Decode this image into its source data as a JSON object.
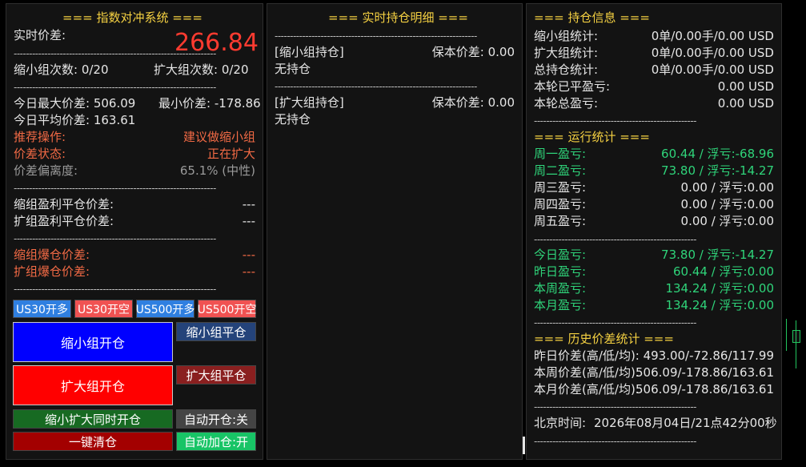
{
  "left": {
    "title": "=== 指数对冲系统 ===",
    "realtime_label": "实时价差:",
    "realtime_value": "266.84",
    "shrink_count": "缩小组次数: 0/20",
    "expand_count": "扩大组次数: 0/20",
    "today_max": "今日最大价差: 506.09",
    "today_min": "最小价差: -178.86",
    "today_avg": "今日平均价差: 163.61",
    "recommend_label": "推荐操作:",
    "recommend_value": "建议做缩小组",
    "spread_state_label": "价差状态:",
    "spread_state_value": "正在扩大",
    "deviation_label": "价差偏离度:",
    "deviation_value": "65.1% (中性)",
    "shrink_tp_label": "缩组盈利平仓价差:",
    "shrink_tp_value": "---",
    "expand_tp_label": "扩组盈利平仓价差:",
    "expand_tp_value": "---",
    "shrink_liq_label": "缩组爆仓价差:",
    "shrink_liq_value": "---",
    "expand_liq_label": "扩组爆仓价差:",
    "expand_liq_value": "---",
    "buttons": {
      "us30_long": "US30开多",
      "us30_short": "US30开空",
      "us500_long": "US500开多",
      "us500_short": "US500开空",
      "shrink_open": "缩小组开仓",
      "shrink_close": "缩小组平仓",
      "expand_open": "扩大组开仓",
      "expand_close": "扩大组平仓",
      "both_open": "缩小扩大同时开仓",
      "auto_open": "自动开仓:关",
      "close_all": "一键清仓",
      "auto_add": "自动加仓:开"
    }
  },
  "middle": {
    "title": "=== 实时持仓明细 ===",
    "shrink_header": "[缩小组持仓]",
    "shrink_breakeven": "保本价差: 0.00",
    "shrink_none": "无持仓",
    "expand_header": "[扩大组持仓]",
    "expand_breakeven": "保本价差: 0.00",
    "expand_none": "无持仓"
  },
  "right": {
    "pos_title": "=== 持仓信息 ===",
    "pos_rows": [
      {
        "label": "缩小组统计:",
        "value": "0单/0.00手/0.00 USD"
      },
      {
        "label": "扩大组统计:",
        "value": "0单/0.00手/0.00 USD"
      },
      {
        "label": "总持仓统计:",
        "value": "0单/0.00手/0.00 USD"
      },
      {
        "label": "本轮已平盈亏:",
        "value": "0.00 USD"
      },
      {
        "label": "本轮总盈亏:",
        "value": "0.00 USD"
      }
    ],
    "run_title": "=== 运行统计 ===",
    "week_rows": [
      {
        "label": "周一盈亏:",
        "value": "60.44 / 浮亏:-68.96"
      },
      {
        "label": "周二盈亏:",
        "value": "73.80 / 浮亏:-14.27"
      },
      {
        "label": "周三盈亏:",
        "value": "0.00 / 浮亏:0.00"
      },
      {
        "label": "周四盈亏:",
        "value": "0.00 / 浮亏:0.00"
      },
      {
        "label": "周五盈亏:",
        "value": "0.00 / 浮亏:0.00"
      }
    ],
    "period_rows": [
      {
        "label": "今日盈亏:",
        "value": "73.80 / 浮亏:-14.27"
      },
      {
        "label": "昨日盈亏:",
        "value": "60.44 / 浮亏:0.00"
      },
      {
        "label": "本周盈亏:",
        "value": "134.24 / 浮亏:0.00"
      },
      {
        "label": "本月盈亏:",
        "value": "134.24 / 浮亏:0.00"
      }
    ],
    "hist_title": "=== 历史价差统计 ===",
    "hist_rows": [
      {
        "label": "昨日价差(高/低/均):",
        "value": "493.00/-72.86/117.99"
      },
      {
        "label": "本周价差(高/低/均):",
        "value": "506.09/-178.86/163.61"
      },
      {
        "label": "本月价差(高/低/均):",
        "value": "506.09/-178.86/163.61"
      }
    ],
    "time_label": "北京时间:",
    "time_value": "2026年08月04日/21点42分00秒"
  },
  "colors": {
    "accent_title": "#f5d142",
    "red": "#ff3b30",
    "green": "#2fd47a",
    "blue_button": "#0000ff",
    "red_button": "#ff0000"
  }
}
